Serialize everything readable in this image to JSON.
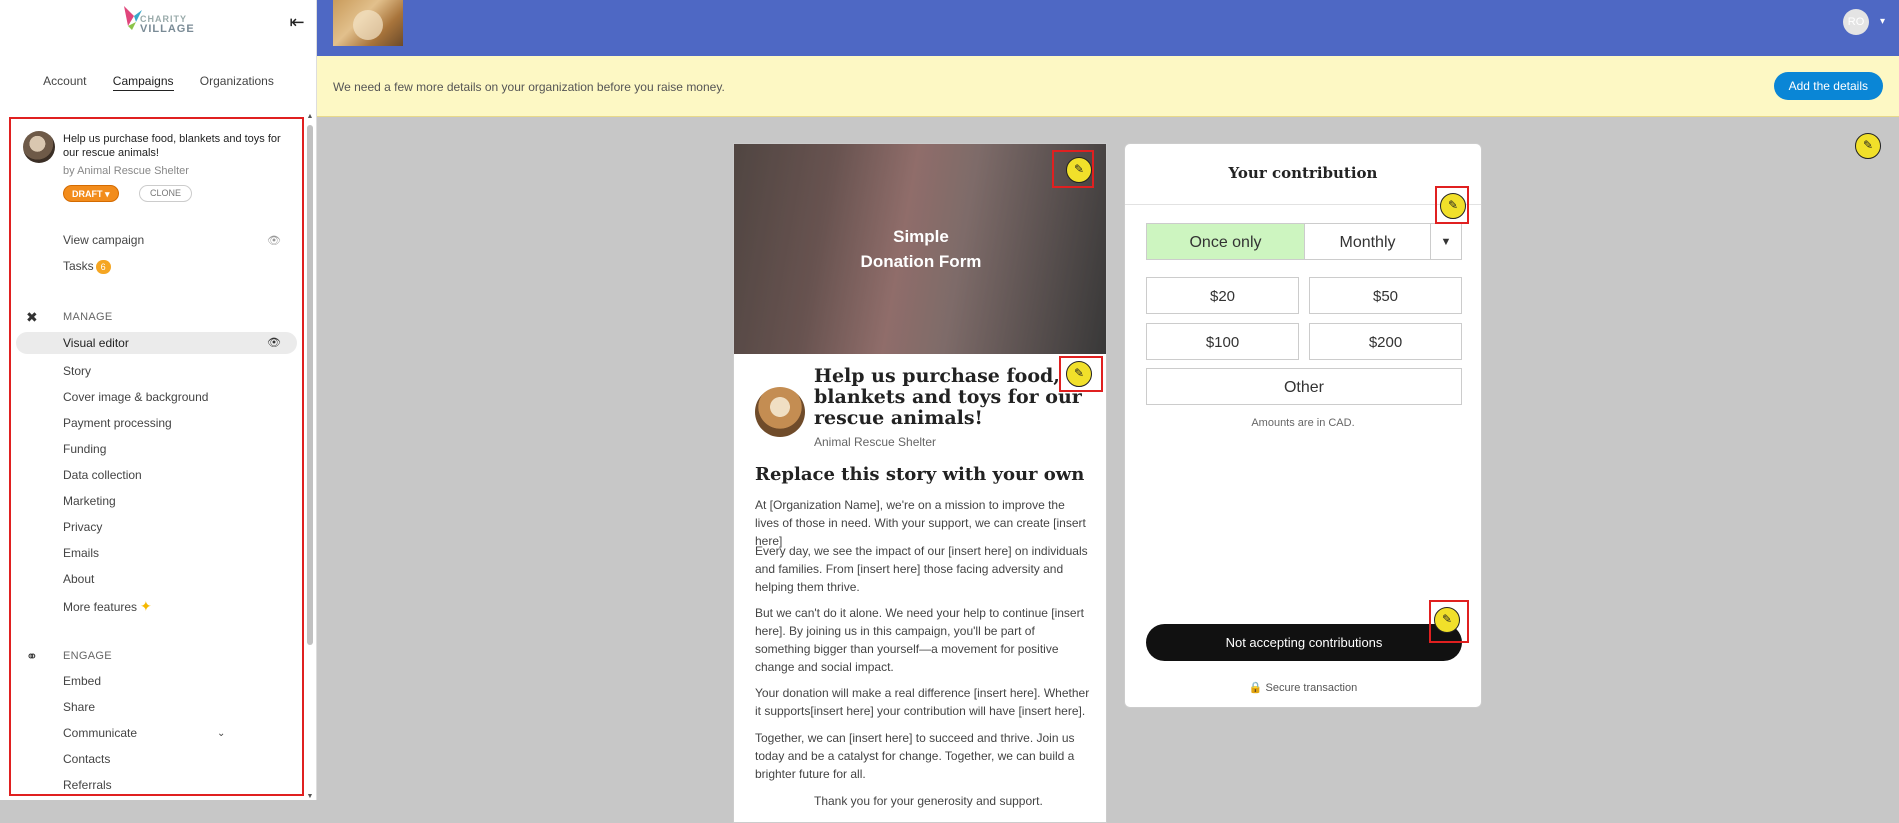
{
  "logo": {
    "line1": "CHARITY",
    "line2": "VILLAGE"
  },
  "sidebar": {
    "tabs": [
      {
        "label": "Account"
      },
      {
        "label": "Campaigns"
      },
      {
        "label": "Organizations"
      }
    ],
    "campaign": {
      "title": "Help us purchase food, blankets and toys for our rescue animals!",
      "by": "by Animal Rescue Shelter",
      "status": "DRAFT",
      "clone_label": "CLONE"
    },
    "view_campaign": "View campaign",
    "tasks": {
      "label": "Tasks",
      "count": "6"
    },
    "manage": {
      "header": "MANAGE",
      "items": [
        {
          "label": "Visual editor"
        },
        {
          "label": "Story"
        },
        {
          "label": "Cover image & background"
        },
        {
          "label": "Payment processing"
        },
        {
          "label": "Funding"
        },
        {
          "label": "Data collection"
        },
        {
          "label": "Marketing"
        },
        {
          "label": "Privacy"
        },
        {
          "label": "Emails"
        },
        {
          "label": "About"
        },
        {
          "label": "More features"
        }
      ]
    },
    "engage": {
      "header": "ENGAGE",
      "items": [
        {
          "label": "Embed"
        },
        {
          "label": "Share"
        },
        {
          "label": "Communicate"
        },
        {
          "label": "Contacts"
        },
        {
          "label": "Referrals"
        }
      ]
    }
  },
  "header": {
    "user_initials": "RO"
  },
  "notice": {
    "text": "We need a few more details on your organization before you raise money.",
    "button": "Add the details"
  },
  "preview": {
    "hero_text_line1": "Simple",
    "hero_text_line2": "Donation Form",
    "title": "Help us purchase food, blankets and toys for our rescue animals!",
    "org": "Animal Rescue Shelter",
    "story_heading": "Replace this story with your own",
    "paragraphs": [
      "At [Organization Name], we're on a mission to improve the lives of those in need. With your support, we can create [insert here]",
      "Every day, we see the impact of our [insert here] on individuals and families. From [insert here] those facing adversity and helping them thrive.",
      "But we can't do it alone. We need your help to continue [insert here]. By joining us in this campaign, you'll be part of something bigger than yourself—a movement for positive change and social impact.",
      "Your donation will make a real difference [insert here]. Whether it supports[insert here] your contribution will have [insert here].",
      "Together, we can [insert here] to succeed and thrive. Join us today and be a catalyst for change. Together, we can build a brighter future for all.",
      "Thank you for your generosity and support."
    ]
  },
  "contribution": {
    "title": "Your contribution",
    "once_only": "Once only",
    "monthly": "Monthly",
    "amounts": [
      "$20",
      "$50",
      "$100",
      "$200"
    ],
    "other": "Other",
    "currency_note": "Amounts are in CAD.",
    "cta": "Not accepting contributions",
    "secure": "Secure transaction"
  },
  "colors": {
    "header_bg": "#4e68c4",
    "notice_bg": "#fdf8c4",
    "notice_button": "#0a86d6",
    "draft_badge": "#f28c1c",
    "edit_button": "#f1e02a",
    "highlight_box": "#e02020",
    "once_only_selected": "#cdf5c0"
  }
}
